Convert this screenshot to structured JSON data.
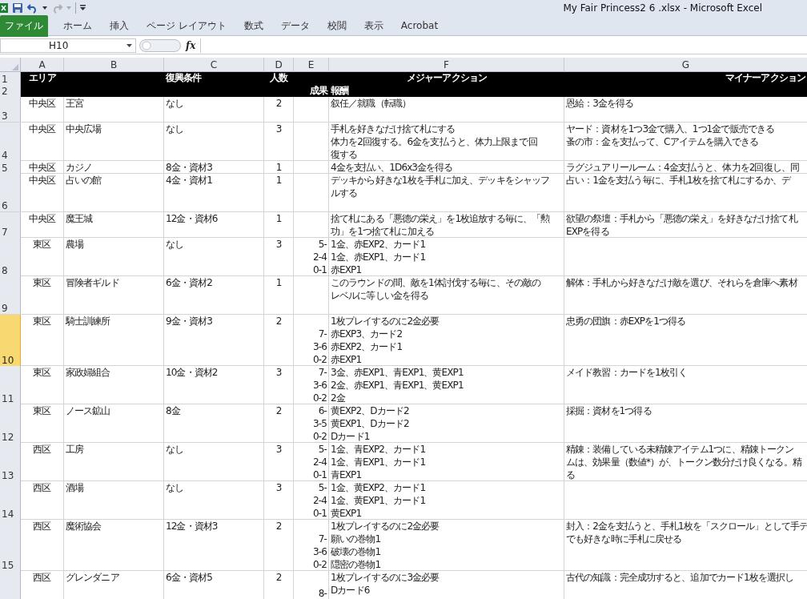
{
  "window": {
    "title": "My Fair Princess2 6 .xlsx - Microsoft Excel"
  },
  "ribbon_tabs": [
    {
      "label": "ファイル",
      "kind": "file"
    },
    {
      "label": "ホーム",
      "kind": "tab"
    },
    {
      "label": "挿入",
      "kind": "tab"
    },
    {
      "label": "ページ レイアウト",
      "kind": "tab"
    },
    {
      "label": "数式",
      "kind": "tab"
    },
    {
      "label": "データ",
      "kind": "tab"
    },
    {
      "label": "校閲",
      "kind": "tab"
    },
    {
      "label": "表示",
      "kind": "tab"
    },
    {
      "label": "Acrobat",
      "kind": "tab"
    }
  ],
  "name_box": {
    "value": "H10"
  },
  "formula_bar": {
    "function_label": "fx"
  },
  "columns": [
    "A",
    "B",
    "C",
    "D",
    "E",
    "F",
    "G"
  ],
  "rows": [
    {
      "number": "1",
      "selected": false,
      "kind": "title",
      "a": "エリア",
      "c": "復興条件",
      "d": "人数",
      "f": [
        "メジャーアクション"
      ],
      "g": [
        "マイナーアクション"
      ]
    },
    {
      "number": "2",
      "selected": false,
      "kind": "title",
      "e": [
        "成果"
      ],
      "f": [
        "報酬"
      ]
    },
    {
      "number": "3",
      "selected": false,
      "kind": "data",
      "a": "中央区",
      "b": "王宮",
      "c": "なし",
      "d": "2",
      "f": [
        "叙任／就職（転職）"
      ],
      "g": [
        "恩給：3金を得る"
      ]
    },
    {
      "number": "4",
      "selected": false,
      "kind": "data",
      "a": "中央区",
      "b": "中央広場",
      "c": "なし",
      "d": "3",
      "f": [
        "手札を好きなだけ捨て札にする",
        "体力を2回復する。6金を支払うと、体力上限まで回",
        "復する"
      ],
      "g": [
        "ヤード：資材を1つ3金で購入、1つ1金で販売できる",
        "蚤の市：金を支払って、Cアイテムを購入できる"
      ]
    },
    {
      "number": "5",
      "selected": false,
      "kind": "data",
      "a": "中央区",
      "b": "カジノ",
      "c": "8金・資材3",
      "d": "1",
      "f": [
        "4金を支払い、1D6x3金を得る"
      ],
      "g": [
        "ラグジュアリールーム：4金支払うと、体力を2回復し、同"
      ]
    },
    {
      "number": "6",
      "selected": false,
      "kind": "data",
      "a": "中央区",
      "b": "占いの館",
      "c": "4金・資材1",
      "d": "1",
      "f": [
        "デッキから好きな1枚を手札に加え、デッキをシャッフ",
        "ルする"
      ],
      "g": [
        "占い：1金を支払う毎に、手札1枚を捨て札にするか、デ"
      ]
    },
    {
      "number": "7",
      "selected": false,
      "kind": "data",
      "a": "中央区",
      "b": "魔王城",
      "c": "12金・資材6",
      "d": "1",
      "f": [
        "捨て札にある「悪徳の栄え」を1枚追放する毎に、「勲",
        "功」を1つ捨て札に加える"
      ],
      "g": [
        "欲望の祭壇：手札から「悪徳の栄え」を好きなだけ捨て札",
        "EXPを得る"
      ]
    },
    {
      "number": "8",
      "selected": false,
      "kind": "data",
      "a": "東区",
      "b": "農場",
      "c": "なし",
      "d": "3",
      "e": [
        "5-",
        "2-4",
        "0-1"
      ],
      "f": [
        "1金、赤EXP2、カード1",
        "1金、赤EXP1、カード1",
        "赤EXP1"
      ]
    },
    {
      "number": "9",
      "selected": false,
      "kind": "data",
      "a": "東区",
      "b": "冒険者ギルド",
      "c": "6金・資材2",
      "d": "1",
      "f": [
        "このラウンドの間、敵を1体討伐する毎に、その敵の",
        "レベルに等しい金を得る"
      ],
      "g": [
        "解体：手札から好きなだけ敵を選び、それらを倉庫へ素材"
      ]
    },
    {
      "number": "10",
      "selected": true,
      "kind": "data",
      "a": "東区",
      "b": "騎士訓練所",
      "c": "9金・資材3",
      "d": "2",
      "e": [
        "7-",
        "3-6",
        "0-2"
      ],
      "f": [
        "1枚プレイするのに2金必要",
        "赤EXP3、カード2",
        "赤EXP2、カード1",
        "赤EXP1"
      ],
      "g": [
        "忠勇の団旗：赤EXPを1つ得る"
      ]
    },
    {
      "number": "11",
      "selected": false,
      "kind": "data",
      "a": "東区",
      "b": "家政婦組合",
      "c": "10金・資材2",
      "d": "3",
      "e": [
        "7-",
        "3-6",
        "0-2"
      ],
      "f": [
        "3金、赤EXP1、青EXP1、黄EXP1",
        "2金、赤EXP1、青EXP1、黄EXP1",
        "2金"
      ],
      "g": [
        "メイド教習：カードを1枚引く"
      ]
    },
    {
      "number": "12",
      "selected": false,
      "kind": "data",
      "a": "東区",
      "b": "ノース鉱山",
      "c": "8金",
      "d": "2",
      "e": [
        "6-",
        "3-5",
        "0-2"
      ],
      "f": [
        "黄EXP2、Dカード2",
        "黄EXP1、Dカード2",
        "Dカード1"
      ],
      "g": [
        "採掘：資材を1つ得る"
      ]
    },
    {
      "number": "13",
      "selected": false,
      "kind": "data",
      "a": "西区",
      "b": "工房",
      "c": "なし",
      "d": "3",
      "e": [
        "5-",
        "2-4",
        "0-1"
      ],
      "f": [
        "1金、青EXP2、カード1",
        "1金、青EXP1、カード1",
        "青EXP1"
      ],
      "g": [
        "精錬：装備している未精錬アイテム1つに、精錬トークン",
        "ムは、効果量（数値*）が、トークン数分だけ良くなる。精",
        "る"
      ]
    },
    {
      "number": "14",
      "selected": false,
      "kind": "data",
      "a": "西区",
      "b": "酒場",
      "c": "なし",
      "d": "3",
      "e": [
        "5-",
        "2-4",
        "0-1"
      ],
      "f": [
        "1金、黄EXP2、カード1",
        "1金、黄EXP1、カード1",
        "黄EXP1"
      ]
    },
    {
      "number": "15",
      "selected": false,
      "kind": "data",
      "a": "西区",
      "b": "魔術協会",
      "c": "12金・資材3",
      "d": "2",
      "e": [
        "7-",
        "3-6",
        "0-2"
      ],
      "f": [
        "1枚プレイするのに2金必要",
        "願いの巻物1",
        "破壊の巻物1",
        "隠密の巻物1"
      ],
      "g": [
        "封入：2金を支払うと、手札1枚を「スクロール」として手テ",
        "でも好きな時に手札に戻せる"
      ]
    },
    {
      "number": "",
      "selected": false,
      "kind": "data",
      "a": "西区",
      "b": "グレンダニア",
      "c": "6金・資材5",
      "d": "2",
      "e": [
        "8-"
      ],
      "f": [
        "1枚プレイするのに3金必要",
        "Dカード6"
      ],
      "g": [
        "古代の知識：完全成功すると、追加でカード1枚を選択し"
      ]
    }
  ]
}
